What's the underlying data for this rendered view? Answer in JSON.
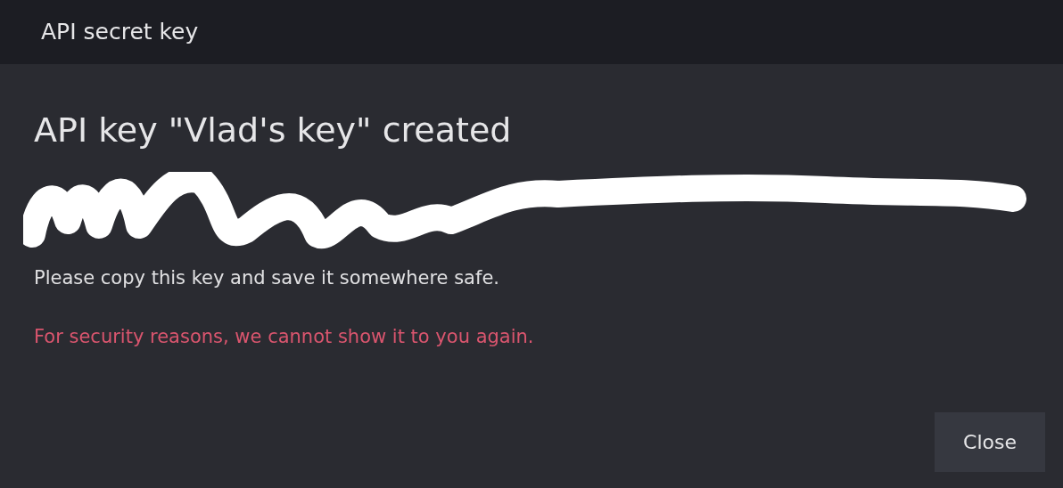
{
  "window": {
    "title": "API secret key"
  },
  "dialog": {
    "heading": "API key \"Vlad's key\" created",
    "key": {
      "redacted": true
    },
    "note": "Please copy this key and save it somewhere safe.",
    "warning": "For security reasons, we cannot show it to you again.",
    "buttons": [
      "Close"
    ]
  }
}
